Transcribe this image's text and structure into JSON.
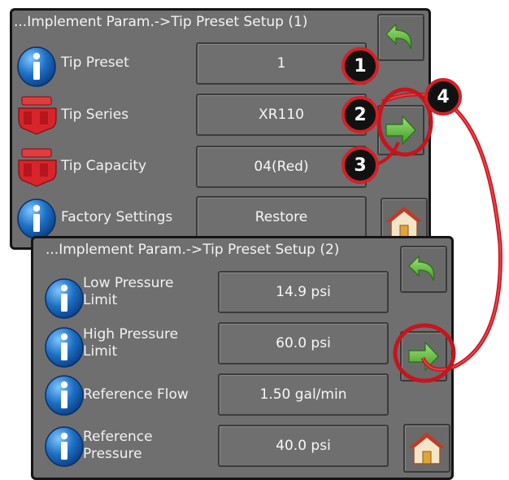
{
  "panel1": {
    "title": "...Implement Param.->Tip Preset Setup (1)",
    "rows": [
      {
        "label": "Tip Preset",
        "value": "1",
        "icon": "info-icon"
      },
      {
        "label": "Tip Series",
        "value": "XR110",
        "icon": "nozzle-icon"
      },
      {
        "label": "Tip Capacity",
        "value": "04(Red)",
        "icon": "nozzle-icon"
      },
      {
        "label": "Factory Settings",
        "value": "Restore",
        "icon": "info-icon"
      }
    ],
    "buttons": {
      "back": "back-arrow-icon",
      "next": "next-arrow-icon",
      "home": "home-icon"
    }
  },
  "panel2": {
    "title": "...Implement Param.->Tip Preset Setup (2)",
    "rows": [
      {
        "label": "Low Pressure\nLimit",
        "value": "14.9 psi",
        "icon": "info-icon"
      },
      {
        "label": "High Pressure\nLimit",
        "value": "60.0 psi",
        "icon": "info-icon"
      },
      {
        "label": "Reference Flow",
        "value": "1.50 gal/min",
        "icon": "info-icon"
      },
      {
        "label": "Reference\nPressure",
        "value": "40.0 psi",
        "icon": "info-icon"
      }
    ],
    "buttons": {
      "back": "back-arrow-icon",
      "next": "next-arrow-icon",
      "home": "home-icon"
    }
  },
  "callouts": [
    "1",
    "2",
    "3",
    "4"
  ],
  "colors": {
    "panel": "#6f6f6f",
    "callout_ring": "#d62027",
    "arrow_green": "#5fb83a",
    "info_blue": "#1d6fc4",
    "nozzle_red": "#d8242a"
  }
}
